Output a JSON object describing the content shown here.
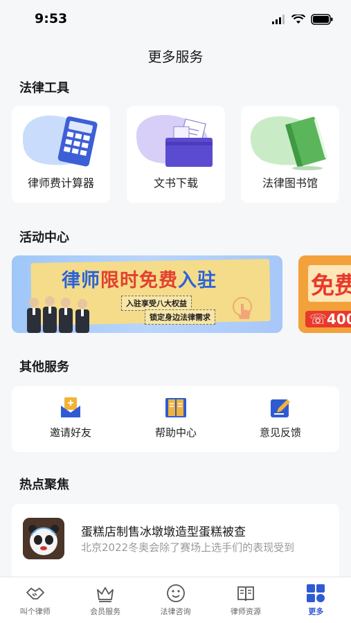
{
  "status": {
    "time": "9:53"
  },
  "nav": {
    "title": "更多服务"
  },
  "legal_tools": {
    "title": "法律工具",
    "items": [
      {
        "label": "律师费计算器",
        "icon": "calculator-icon"
      },
      {
        "label": "文书下载",
        "icon": "folder-documents-icon"
      },
      {
        "label": "法律图书馆",
        "icon": "book-icon"
      }
    ]
  },
  "activity": {
    "title": "活动中心",
    "banner_main": {
      "headline_a": "律师",
      "headline_b": "限时免费",
      "headline_c": "入驻",
      "sub1": "入驻享受八大权益",
      "sub2": "锁定身边法律需求"
    },
    "banner_side": {
      "text": "免费",
      "phone": "400"
    }
  },
  "other_services": {
    "title": "其他服务",
    "items": [
      {
        "label": "邀请好友",
        "icon": "envelope-plus-icon"
      },
      {
        "label": "帮助中心",
        "icon": "open-book-icon"
      },
      {
        "label": "意见反馈",
        "icon": "edit-pencil-icon"
      }
    ]
  },
  "hot_topics": {
    "title": "热点聚焦",
    "items": [
      {
        "title": "蛋糕店制售冰墩墩造型蛋糕被查",
        "summary": "北京2022冬奥会除了赛场上选手们的表现受到"
      }
    ]
  },
  "tabbar": {
    "items": [
      {
        "label": "叫个律师",
        "icon": "handshake-icon"
      },
      {
        "label": "会员服务",
        "icon": "crown-icon"
      },
      {
        "label": "法律咨询",
        "icon": "smiley-icon"
      },
      {
        "label": "律师资源",
        "icon": "book-resources-icon"
      },
      {
        "label": "更多",
        "icon": "grid-more-icon"
      }
    ],
    "active_index": 4,
    "active_color": "#2f5bd2"
  }
}
